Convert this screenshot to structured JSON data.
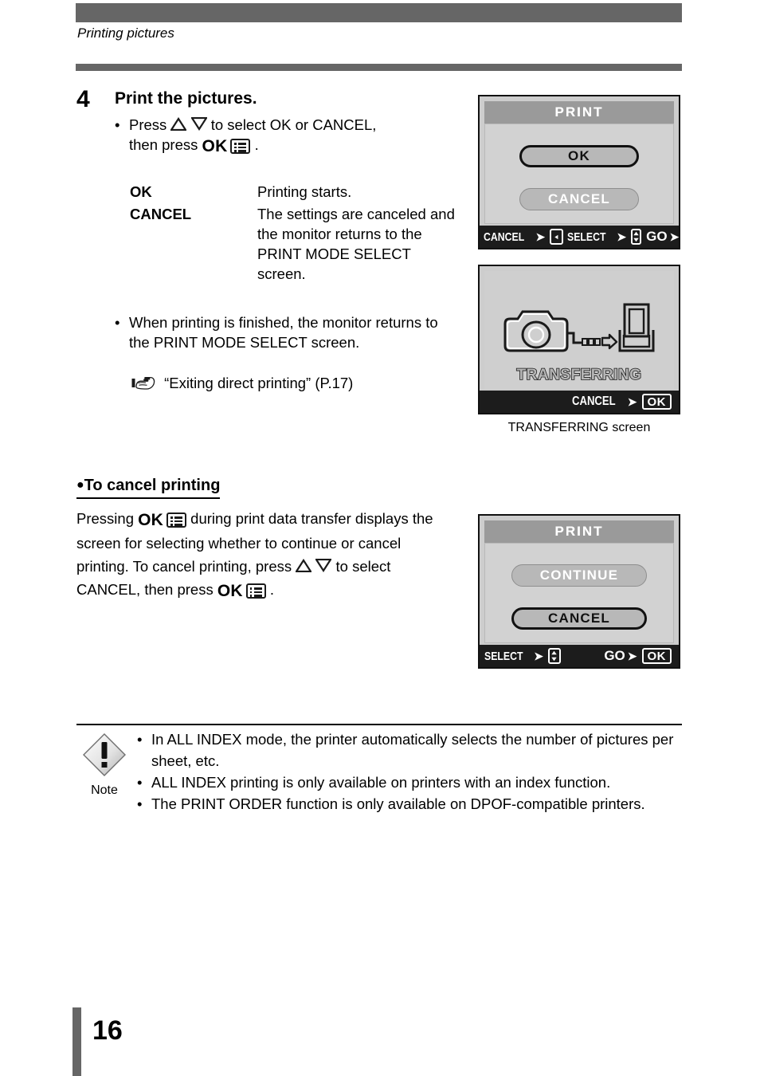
{
  "header": {
    "running_title": "Printing pictures"
  },
  "step": {
    "number": "4",
    "title": "Print the pictures.",
    "bullet1_pre": "Press",
    "bullet1_mid": "to select OK or CANCEL,",
    "bullet1_line2_pre": "then press",
    "ok_label": "OK",
    "period": ".",
    "terms": [
      {
        "term": "OK",
        "desc": "Printing starts."
      },
      {
        "term": "CANCEL",
        "desc": "The settings are canceled and the monitor returns to the PRINT MODE SELECT screen."
      }
    ],
    "bullet2": "When printing is finished, the monitor returns to the PRINT MODE SELECT screen.",
    "reference": "“Exiting direct printing” (P.17)"
  },
  "cancel_section": {
    "heading": "To cancel printing",
    "para_part1": "Pressing",
    "para_part2": "during print data transfer displays the screen for selecting whether to continue or cancel printing. To cancel printing, press",
    "para_part3": "to select CANCEL, then press",
    "para_part4": ".",
    "ok_label": "OK"
  },
  "screens": [
    {
      "id": "print-ok-cancel",
      "title": "PRINT",
      "buttons": [
        {
          "label": "OK",
          "selected": true
        },
        {
          "label": "CANCEL",
          "selected": false
        }
      ],
      "status": [
        {
          "text": "CANCEL",
          "arrow": "⮞",
          "key": "◀",
          "key_type": "left"
        },
        {
          "text": "SELECT",
          "arrow": "⮞",
          "key": "updown",
          "key_type": "updown"
        },
        {
          "text": "GO",
          "arrow": "⮞",
          "key": "OK",
          "key_type": "ok"
        }
      ]
    },
    {
      "id": "transferring",
      "label": "TRANSFERRING",
      "status": [
        {
          "text": "CANCEL",
          "arrow": "⮞",
          "key": "OK",
          "key_type": "ok"
        }
      ],
      "caption": "TRANSFERRING screen"
    },
    {
      "id": "print-continue-cancel",
      "title": "PRINT",
      "buttons": [
        {
          "label": "CONTINUE",
          "selected": false
        },
        {
          "label": "CANCEL",
          "selected": true
        }
      ],
      "status": [
        {
          "text": "SELECT",
          "arrow": "⮞",
          "key": "updown",
          "key_type": "updown"
        },
        {
          "text": "GO",
          "arrow": "⮞",
          "key": "OK",
          "key_type": "ok"
        }
      ]
    }
  ],
  "note": {
    "label": "Note",
    "items": [
      "In ALL INDEX mode, the printer automatically selects the number of pictures per sheet, etc.",
      "ALL INDEX printing is only available on printers with an index function.",
      "The PRINT ORDER function is only available on DPOF-compatible printers."
    ]
  },
  "footer": {
    "page_number": "16"
  }
}
